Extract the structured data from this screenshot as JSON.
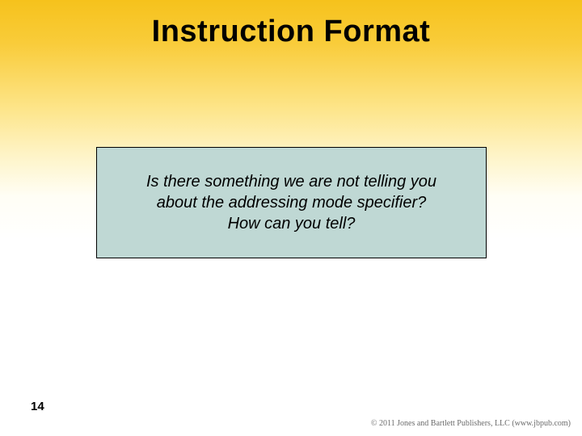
{
  "slide": {
    "title": "Instruction Format",
    "callout_line1": "Is there something we are not telling you",
    "callout_line2": "about the addressing mode specifier?",
    "callout_line3": "How can you tell?",
    "page_number": "14",
    "copyright": "© 2011 Jones and Bartlett Publishers, LLC (www.jbpub.com)"
  }
}
